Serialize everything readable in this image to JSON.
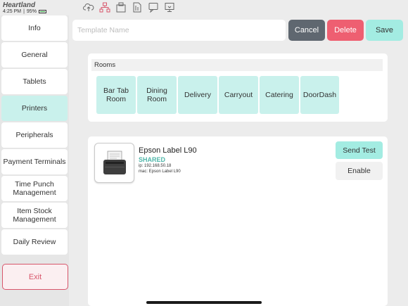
{
  "status_bar": {
    "brand": "Heartland",
    "time": "4:25 PM",
    "separator": "|",
    "battery": "95%",
    "icons": [
      "cloud-upload-icon",
      "network-icon",
      "printer-box-icon",
      "document-icon",
      "receipt-icon",
      "display-icon"
    ]
  },
  "sidebar": {
    "items": [
      {
        "label": "Info"
      },
      {
        "label": "General"
      },
      {
        "label": "Tablets"
      },
      {
        "label": "Printers"
      },
      {
        "label": "Peripherals"
      },
      {
        "label": "Payment Terminals"
      },
      {
        "label": "Time Punch Management"
      },
      {
        "label": "Item Stock Management"
      },
      {
        "label": "Daily Review"
      }
    ],
    "active": "Printers",
    "exit_label": "Exit"
  },
  "template": {
    "placeholder": "Template Name",
    "value": ""
  },
  "toolbar": {
    "cancel_label": "Cancel",
    "delete_label": "Delete",
    "save_label": "Save"
  },
  "rooms": {
    "title": "Rooms",
    "items": [
      {
        "label": "Bar Tab Room"
      },
      {
        "label": "Dining Room"
      },
      {
        "label": "Delivery"
      },
      {
        "label": "Carryout"
      },
      {
        "label": "Catering"
      },
      {
        "label": "DoorDash"
      }
    ]
  },
  "printer": {
    "name": "Epson Label L90",
    "status": "SHARED",
    "ip": "ip: 192.168.50.18",
    "mac": "mac: Epson Label L90",
    "send_test_label": "Send Test",
    "enable_label": "Enable",
    "icon": "printer-icon"
  },
  "colors": {
    "accent": "#a3ece2",
    "active_nav": "#c9f1ec",
    "cancel": "#5f6770",
    "delete": "#ee5f71",
    "exit": "#d8566b",
    "shared": "#4fb6a9"
  }
}
